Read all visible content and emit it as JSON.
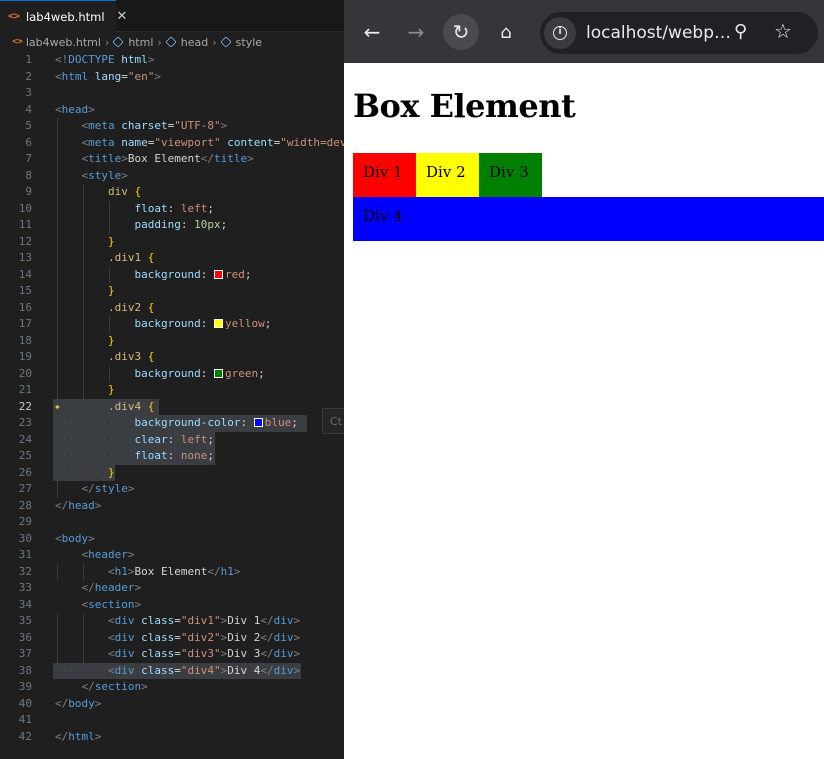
{
  "editor": {
    "tab_label": "lab4web.html",
    "tab_close": "✕",
    "breadcrumb": [
      "lab4web.html",
      "html",
      "head",
      "style"
    ],
    "hint": "Ct",
    "lines": [
      {
        "n": "1",
        "html": "<span class='t-br'>&lt;!</span><span class='t-tag'>DOCTYPE</span> <span class='t-attr'>html</span><span class='t-br'>&gt;</span>"
      },
      {
        "n": "2",
        "html": "<span class='t-br'>&lt;</span><span class='t-tag'>html</span> <span class='t-attr'>lang</span><span class='t-txt'>=</span><span class='t-str'>\"en\"</span><span class='t-br'>&gt;</span>"
      },
      {
        "n": "3",
        "html": ""
      },
      {
        "n": "4",
        "html": "<span class='t-br'>&lt;</span><span class='t-tag'>head</span><span class='t-br'>&gt;</span>"
      },
      {
        "n": "5",
        "html": "    <span class='t-br'>&lt;</span><span class='t-tag'>meta</span> <span class='t-attr'>charset</span><span class='t-txt'>=</span><span class='t-str'>\"UTF-8\"</span><span class='t-br'>&gt;</span>"
      },
      {
        "n": "6",
        "html": "    <span class='t-br'>&lt;</span><span class='t-tag'>meta</span> <span class='t-attr'>name</span><span class='t-txt'>=</span><span class='t-str'>\"viewport\"</span> <span class='t-attr'>content</span><span class='t-txt'>=</span><span class='t-str'>\"width=dev</span>"
      },
      {
        "n": "7",
        "html": "    <span class='t-br'>&lt;</span><span class='t-tag'>title</span><span class='t-br'>&gt;</span><span class='t-txt'>Box Element</span><span class='t-br'>&lt;/</span><span class='t-tag'>title</span><span class='t-br'>&gt;</span>"
      },
      {
        "n": "8",
        "html": "    <span class='t-br'>&lt;</span><span class='t-tag'>style</span><span class='t-br'>&gt;</span>"
      },
      {
        "n": "9",
        "html": "        <span class='t-sel'>div</span> <span class='t-brace'>{</span>"
      },
      {
        "n": "10",
        "html": "            <span class='t-prop'>float</span><span class='t-txt'>: </span><span class='t-val'>left</span><span class='t-txt'>;</span>"
      },
      {
        "n": "11",
        "html": "            <span class='t-prop'>padding</span><span class='t-txt'>: </span><span class='t-num'>10px</span><span class='t-txt'>;</span>"
      },
      {
        "n": "12",
        "html": "        <span class='t-brace'>}</span>"
      },
      {
        "n": "13",
        "html": "        <span class='t-sel'>.div1</span> <span class='t-brace'>{</span>"
      },
      {
        "n": "14",
        "html": "            <span class='t-prop'>background</span><span class='t-txt'>: </span><span class='swatch' style='background:#ff0000'></span><span class='t-val'>red</span><span class='t-txt'>;</span>"
      },
      {
        "n": "15",
        "html": "        <span class='t-brace'>}</span>"
      },
      {
        "n": "16",
        "html": "        <span class='t-sel'>.div2</span> <span class='t-brace'>{</span>"
      },
      {
        "n": "17",
        "html": "            <span class='t-prop'>background</span><span class='t-txt'>: </span><span class='swatch' style='background:#ffff00'></span><span class='t-val'>yellow</span><span class='t-txt'>;</span>"
      },
      {
        "n": "18",
        "html": "        <span class='t-brace'>}</span>"
      },
      {
        "n": "19",
        "html": "        <span class='t-sel'>.div3</span> <span class='t-brace'>{</span>"
      },
      {
        "n": "20",
        "html": "            <span class='t-prop'>background</span><span class='t-txt'>: </span><span class='swatch' style='background:#008000'></span><span class='t-val'>green</span><span class='t-txt'>;</span>"
      },
      {
        "n": "21",
        "html": "        <span class='t-brace'>}</span>"
      },
      {
        "n": "22",
        "html": "<span class='dots'>    ····</span><span class='t-sel'>.div4</span> <span class='t-brace'>{</span>",
        "current": true,
        "hl": 106
      },
      {
        "n": "23",
        "html": "<span class='dots'>········</span><span class='dots'>····</span><span class='t-prop'>background-color</span><span class='t-txt'>: </span><span class='swatch' style='background:#0000ff'></span><span class='t-val'>blue</span><span class='t-txt'>;</span>",
        "hl": 254
      },
      {
        "n": "24",
        "html": "<span class='dots'>········</span><span class='dots'>····</span><span class='t-prop'>clear</span><span class='t-txt'>: </span><span class='t-val'>left</span><span class='t-txt'>;</span>",
        "hl": 162
      },
      {
        "n": "25",
        "html": "<span class='dots'>········</span><span class='dots'>····</span><span class='t-prop'>float</span><span class='t-txt'>: </span><span class='t-val'>none</span><span class='t-txt'>;</span>",
        "hl": 162
      },
      {
        "n": "26",
        "html": "<span class='dots'>········</span><span class='t-brace'>}</span>",
        "hl": 62
      },
      {
        "n": "27",
        "html": "    <span class='t-br'>&lt;/</span><span class='t-tag'>style</span><span class='t-br'>&gt;</span>"
      },
      {
        "n": "28",
        "html": "<span class='t-br'>&lt;/</span><span class='t-tag'>head</span><span class='t-br'>&gt;</span>"
      },
      {
        "n": "29",
        "html": ""
      },
      {
        "n": "30",
        "html": "<span class='t-br'>&lt;</span><span class='t-tag'>body</span><span class='t-br'>&gt;</span>"
      },
      {
        "n": "31",
        "html": "    <span class='t-br'>&lt;</span><span class='t-tag'>header</span><span class='t-br'>&gt;</span>"
      },
      {
        "n": "32",
        "html": "        <span class='t-br'>&lt;</span><span class='t-tag'>h1</span><span class='t-br'>&gt;</span><span class='t-txt'>Box Element</span><span class='t-br'>&lt;/</span><span class='t-tag'>h1</span><span class='t-br'>&gt;</span>"
      },
      {
        "n": "33",
        "html": "    <span class='t-br'>&lt;/</span><span class='t-tag'>header</span><span class='t-br'>&gt;</span>"
      },
      {
        "n": "34",
        "html": "    <span class='t-br'>&lt;</span><span class='t-tag'>section</span><span class='t-br'>&gt;</span>"
      },
      {
        "n": "35",
        "html": "        <span class='t-br'>&lt;</span><span class='t-tag'>div</span> <span class='t-attr'>class</span><span class='t-txt'>=</span><span class='t-str'>\"div1\"</span><span class='t-br'>&gt;</span><span class='t-txt'>Div 1</span><span class='t-br'>&lt;/</span><span class='t-tag'>div</span><span class='t-br'>&gt;</span>"
      },
      {
        "n": "36",
        "html": "        <span class='t-br'>&lt;</span><span class='t-tag'>div</span> <span class='t-attr'>class</span><span class='t-txt'>=</span><span class='t-str'>\"div2\"</span><span class='t-br'>&gt;</span><span class='t-txt'>Div 2</span><span class='t-br'>&lt;/</span><span class='t-tag'>div</span><span class='t-br'>&gt;</span>"
      },
      {
        "n": "37",
        "html": "        <span class='t-br'>&lt;</span><span class='t-tag'>div</span> <span class='t-attr'>class</span><span class='t-txt'>=</span><span class='t-str'>\"div3\"</span><span class='t-br'>&gt;</span><span class='t-txt'>Div 3</span><span class='t-br'>&lt;/</span><span class='t-tag'>div</span><span class='t-br'>&gt;</span>"
      },
      {
        "n": "38",
        "html": "<span class='dots'>········</span><span class='t-br'>&lt;</span><span class='t-tag'>div</span> <span class='t-attr'>class</span><span class='t-txt'>=</span><span class='t-str'>\"div4\"</span><span class='t-br'>&gt;</span><span class='t-txt'>Div 4</span><span class='t-br'>&lt;/</span><span class='t-tag'>div</span><span class='t-br'>&gt;</span>",
        "hl": 248
      },
      {
        "n": "39",
        "html": "    <span class='t-br'>&lt;/</span><span class='t-tag'>section</span><span class='t-br'>&gt;</span>"
      },
      {
        "n": "40",
        "html": "<span class='t-br'>&lt;/</span><span class='t-tag'>body</span><span class='t-br'>&gt;</span>"
      },
      {
        "n": "41",
        "html": ""
      },
      {
        "n": "42",
        "html": "<span class='t-br'>&lt;/</span><span class='t-tag'>html</span><span class='t-br'>&gt;</span>"
      }
    ]
  },
  "browser": {
    "url": "localhost/webp…",
    "icons": [
      "back-icon",
      "forward-icon",
      "reload-icon",
      "home-icon",
      "site-info-icon",
      "zoom-icon",
      "star-icon"
    ],
    "page": {
      "heading": "Box Element",
      "boxes": [
        {
          "label": "Div 1",
          "color": "#ff0000"
        },
        {
          "label": "Div 2",
          "color": "#ffff00"
        },
        {
          "label": "Div 3",
          "color": "#008000"
        },
        {
          "label": "Div 4",
          "color": "#0000ff"
        }
      ]
    }
  },
  "colors": {
    "editor_bg": "#1f1f1f",
    "tab_accent": "#0078d4",
    "browser_toolbar": "#35363a"
  }
}
